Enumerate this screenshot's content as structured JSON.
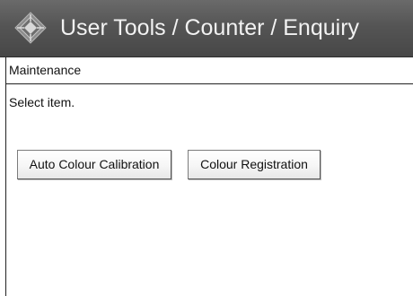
{
  "header": {
    "title": "User Tools / Counter / Enquiry",
    "icon": "user-tools-icon",
    "background": "#555555"
  },
  "subheader": {
    "label": "Maintenance"
  },
  "main": {
    "instruction": "Select item.",
    "buttons": [
      {
        "label": "Auto Colour Calibration"
      },
      {
        "label": "Colour Registration"
      }
    ]
  }
}
